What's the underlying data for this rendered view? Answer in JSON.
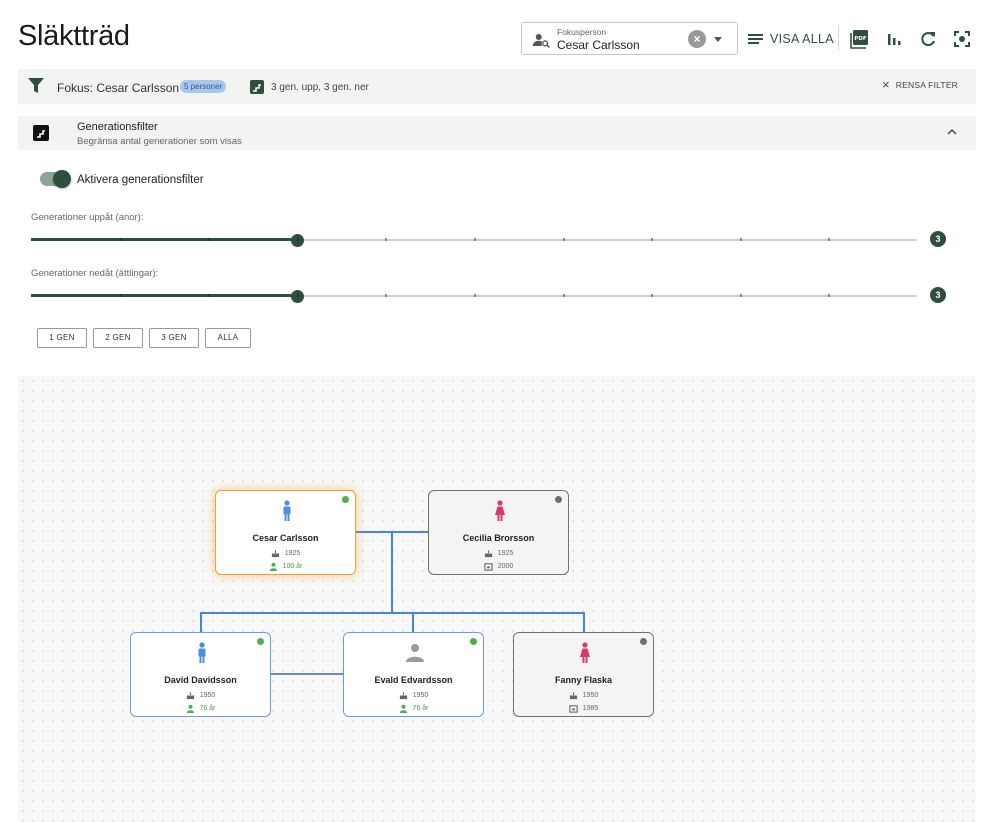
{
  "header": {
    "title": "Släktträd",
    "focus_select": {
      "label": "Fokusperson",
      "value": "Cesar Carlsson"
    },
    "show_all_label": "VISA ALLA",
    "tools": [
      "pdf-icon",
      "stats-icon",
      "refresh-icon",
      "fullscreen-icon"
    ]
  },
  "filter_bar": {
    "focus_text": "Fokus: Cesar Carlsson",
    "count_badge": "5 personer",
    "generation_text": "3 gen. upp, 3 gen. ner",
    "clear_label": "RENSA FILTER"
  },
  "generation_panel": {
    "title": "Generationsfilter",
    "subtitle": "Begränsa antal generationer som visas",
    "toggle_label": "Aktivera generationsfilter",
    "toggle_on": true,
    "up_label": "Generationer uppåt (anor):",
    "up_value": "3",
    "up_fraction": 0.3,
    "down_label": "Generationer nedåt (ättlingar):",
    "down_value": "3",
    "down_fraction": 0.3,
    "presets": [
      "1 GEN",
      "2 GEN",
      "3 GEN",
      "ALLA"
    ]
  },
  "colors": {
    "accent": "#2f4f3d",
    "edge": "#4a84d6",
    "male": "#4a8ee0",
    "female": "#d43a6a",
    "unknown": "#9a9a9a",
    "alive": "#4caf50",
    "deceased": "#707070",
    "focus": "#f0a030"
  },
  "tree": {
    "people": [
      {
        "name": "Cesar Carlsson",
        "gender": "male",
        "born": "1925",
        "age": "100 år",
        "focus": true,
        "alive": true
      },
      {
        "name": "Cecilia Brorsson",
        "gender": "female",
        "born": "1925",
        "died": "2000",
        "alive": false
      },
      {
        "name": "David Davidsson",
        "gender": "male",
        "born": "1950",
        "age": "76 år",
        "alive": true
      },
      {
        "name": "Evald Edvardsson",
        "gender": "unknown",
        "born": "1950",
        "age": "76 år",
        "alive": true
      },
      {
        "name": "Fanny Flaska",
        "gender": "female",
        "born": "1950",
        "died": "1985",
        "alive": false
      }
    ]
  }
}
